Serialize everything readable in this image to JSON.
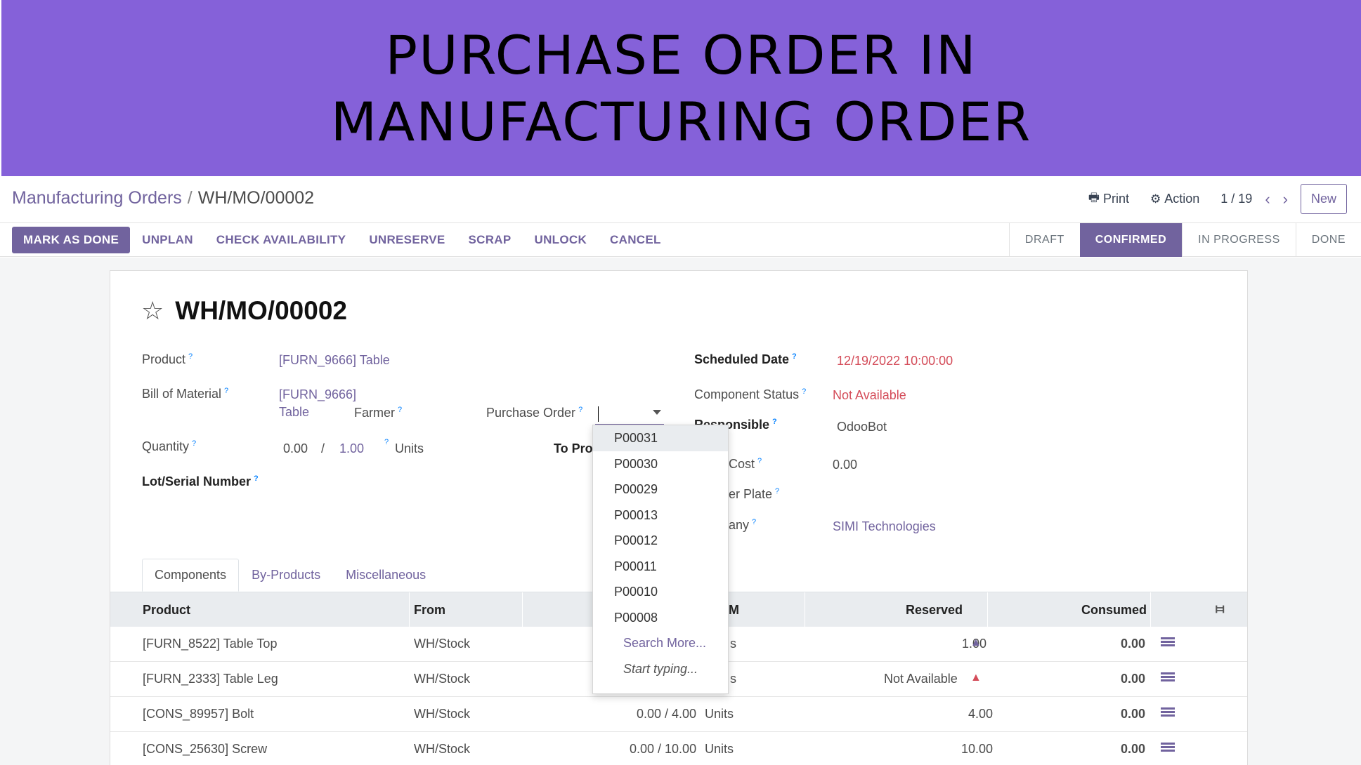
{
  "banner": {
    "title": "PURCHASE ORDER IN MANUFACTURING ORDER"
  },
  "breadcrumb": {
    "parent": "Manufacturing Orders",
    "separator": "/",
    "current": "WH/MO/00002"
  },
  "top_actions": {
    "print": "Print",
    "action": "Action",
    "pager": "1 / 19",
    "new": "New"
  },
  "action_buttons": [
    "MARK AS DONE",
    "UNPLAN",
    "CHECK AVAILABILITY",
    "UNRESERVE",
    "SCRAP",
    "UNLOCK",
    "CANCEL"
  ],
  "status_bar": {
    "stages": [
      "DRAFT",
      "CONFIRMED",
      "IN PROGRESS",
      "DONE"
    ],
    "active": "CONFIRMED"
  },
  "record": {
    "title": "WH/MO/00002",
    "product_label": "Product",
    "product_value": "[FURN_9666] Table",
    "bom_label": "Bill of Material",
    "bom_value_line1": "[FURN_9666]",
    "bom_value_line2": "Table",
    "farmer_label": "Farmer",
    "purchase_order_label": "Purchase Order",
    "quantity_label": "Quantity",
    "quantity_produced": "0.00",
    "quantity_sep": "/",
    "quantity_total": "1.00",
    "quantity_unit": "Units",
    "to_produce_label": "To Pro",
    "lot_label": "Lot/Serial Number",
    "scheduled_date_label": "Scheduled Date",
    "scheduled_date_value": "12/19/2022 10:00:00",
    "component_status_label": "Component Status",
    "component_status_value": "Not Available",
    "responsible_label": "Responsible",
    "responsible_value": "OdooBot",
    "cost_label": "Cost",
    "cost_value": "0.00",
    "plate_label": "er Plate",
    "company_label": "any",
    "company_value": "SIMI Technologies"
  },
  "tabs": [
    "Components",
    "By-Products",
    "Miscellaneous"
  ],
  "table": {
    "headers": {
      "product": "Product",
      "from": "From",
      "uom": "M",
      "reserved": "Reserved",
      "consumed": "Consumed"
    },
    "rows": [
      {
        "product": "[FURN_8522] Table Top",
        "from": "WH/Stock",
        "qty": "",
        "unit": "s",
        "reserved": "1.00",
        "reserved_red": false,
        "consumed": "0.00"
      },
      {
        "product": "[FURN_2333] Table Leg",
        "from": "WH/Stock",
        "qty": "",
        "unit": "s",
        "reserved": "Not Available",
        "reserved_red": true,
        "consumed": "0.00"
      },
      {
        "product": "[CONS_89957] Bolt",
        "from": "WH/Stock",
        "qty": "0.00 / 4.00",
        "unit": "Units",
        "reserved": "4.00",
        "reserved_red": false,
        "consumed": "0.00"
      },
      {
        "product": "[CONS_25630] Screw",
        "from": "WH/Stock",
        "qty": "0.00 / 10.00",
        "unit": "Units",
        "reserved": "10.00",
        "reserved_red": false,
        "consumed": "0.00"
      }
    ]
  },
  "dropdown": {
    "options": [
      "P00031",
      "P00030",
      "P00029",
      "P00013",
      "P00012",
      "P00011",
      "P00010",
      "P00008"
    ],
    "highlighted": "P00031",
    "search_more": "Search More...",
    "start_typing": "Start typing..."
  },
  "colors": {
    "banner": "#8561d9",
    "brand": "#71639e",
    "danger": "#d44c59",
    "success": "#28a745"
  }
}
